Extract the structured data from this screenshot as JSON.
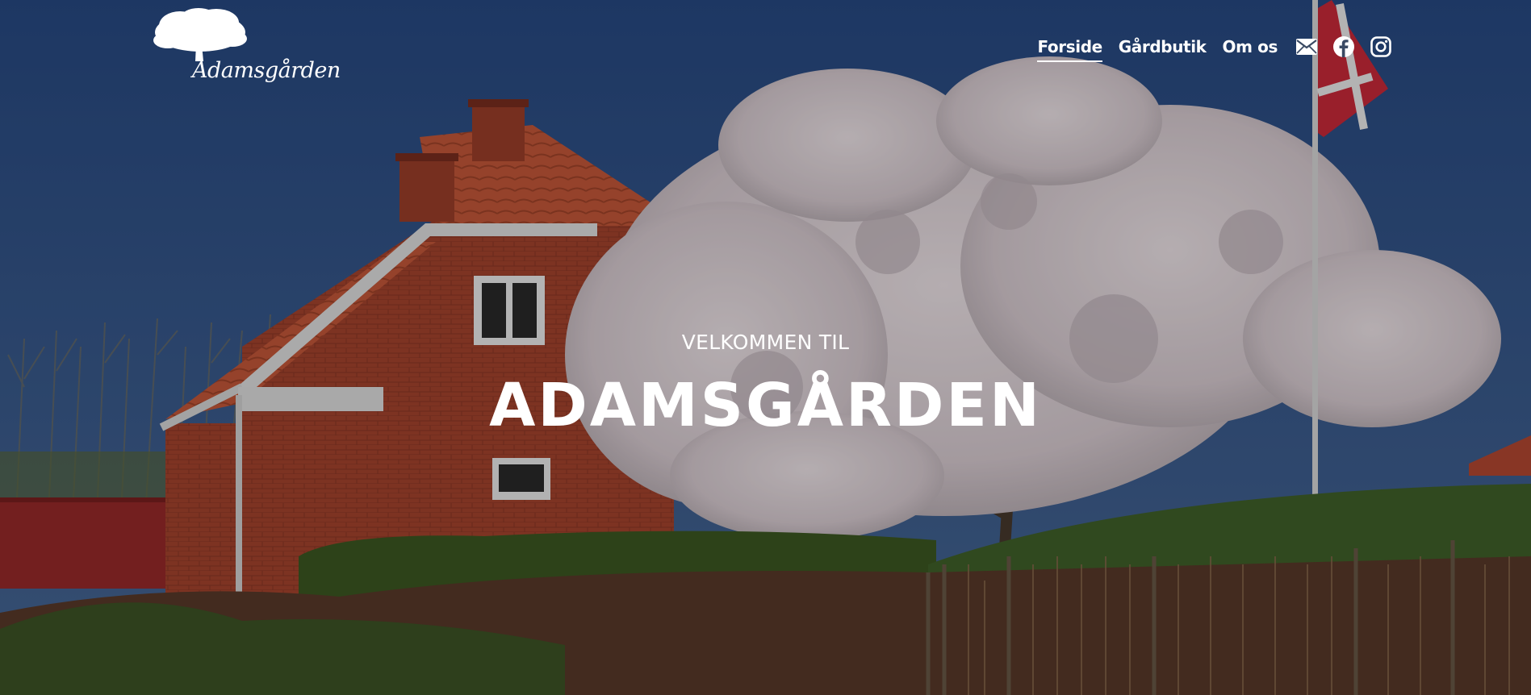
{
  "site": {
    "logo_text": "Adamsgården"
  },
  "nav": {
    "items": [
      {
        "label": "Forside",
        "active": true
      },
      {
        "label": "Gårdbutik",
        "active": false
      },
      {
        "label": "Om os",
        "active": false
      }
    ],
    "icons": [
      "mail-icon",
      "facebook-icon",
      "instagram-icon"
    ]
  },
  "hero": {
    "kicker": "VELKOMMEN TIL",
    "title": "ADAMSGÅRDEN"
  },
  "colors": {
    "sky": "#33507f",
    "brick": "#a8452f",
    "roof": "#c7573a",
    "blossom": "#e8dbe0",
    "hedge": "#3e5a22",
    "text": "#ffffff"
  }
}
